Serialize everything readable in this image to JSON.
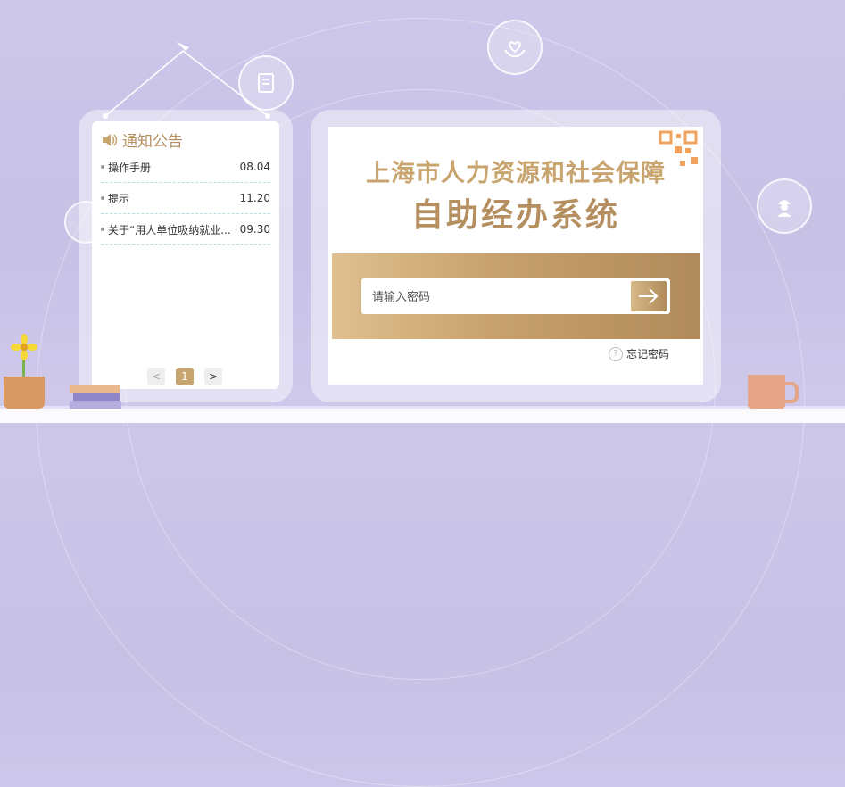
{
  "notice": {
    "title": "通知公告",
    "items": [
      {
        "title": "操作手册",
        "date": "08.04"
      },
      {
        "title": "提示",
        "date": "11.20"
      },
      {
        "title": "关于“用人单位吸纳就业...",
        "date": "09.30"
      }
    ],
    "pagination": {
      "prev": "<",
      "current": "1",
      "next": ">"
    }
  },
  "login": {
    "title_line1": "上海市人力资源和社会保障",
    "title_line2": "自助经办系统",
    "password_placeholder": "请输入密码",
    "password_value": "",
    "forgot_label": "忘记密码"
  },
  "colors": {
    "accent": "#c8a46e",
    "accent_dark": "#b58f5f",
    "background": "#cdc8ea"
  },
  "icons": [
    "speaker-icon",
    "document-icon",
    "heart-hands-icon",
    "worker-icon",
    "arrow-right-icon",
    "help-icon",
    "qr-code-icon"
  ]
}
